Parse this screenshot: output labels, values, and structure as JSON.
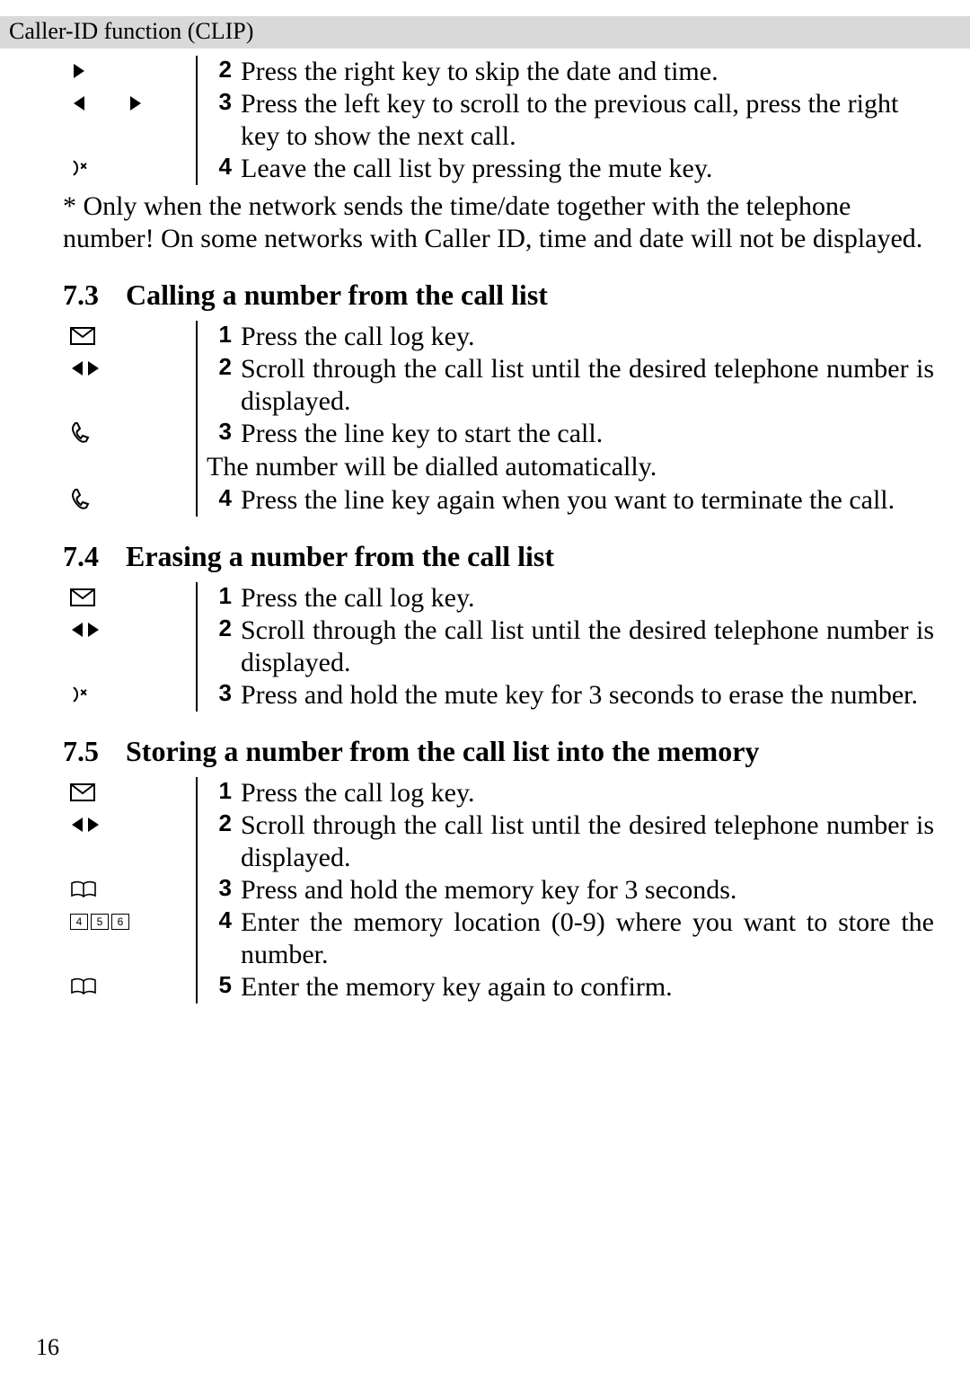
{
  "header": {
    "title": "Caller-ID function (CLIP)"
  },
  "firstBlock": {
    "steps": [
      {
        "n": "2",
        "text": "Press the right key to skip the date and time."
      },
      {
        "n": "3",
        "text": "Press the left key to scroll to the previous call, press the right key to show the next call."
      },
      {
        "n": "4",
        "text": "Leave the call list by pressing the mute key."
      }
    ],
    "footnote": "* Only when the network sends the time/date together with the telephone number! On some networks with Caller ID, time and date will not be displayed."
  },
  "sec73": {
    "num": "7.3",
    "title": "Calling a number from the call list",
    "steps": [
      {
        "n": "1",
        "text": "Press the call log key."
      },
      {
        "n": "2",
        "text": "Scroll through the call list until the desired telephone number is displayed."
      },
      {
        "n": "3",
        "text": "Press the line key to start the call."
      }
    ],
    "note": "The number will be dialled automatically.",
    "step4": {
      "n": "4",
      "text": "Press the line key again when you want to terminate the call."
    }
  },
  "sec74": {
    "num": "7.4",
    "title": "Erasing a number from the call list",
    "steps": [
      {
        "n": "1",
        "text": "Press the call log key."
      },
      {
        "n": "2",
        "text": "Scroll through the call list until the desired telephone number is displayed."
      },
      {
        "n": "3",
        "text": "Press and hold the mute key for 3 seconds to erase the number."
      }
    ]
  },
  "sec75": {
    "num": "7.5",
    "title": "Storing a number from the call list into the memory",
    "steps": [
      {
        "n": "1",
        "text": "Press the call log key."
      },
      {
        "n": "2",
        "text": "Scroll through the call list until the desired telephone number is displayed."
      },
      {
        "n": "3",
        "text": "Press and hold the memory key for 3 seconds."
      },
      {
        "n": "4",
        "text": "Enter the memory location (0-9) where you want to store the number."
      },
      {
        "n": "5",
        "text": "Enter the memory key again to confirm."
      }
    ]
  },
  "pageNumber": "16"
}
